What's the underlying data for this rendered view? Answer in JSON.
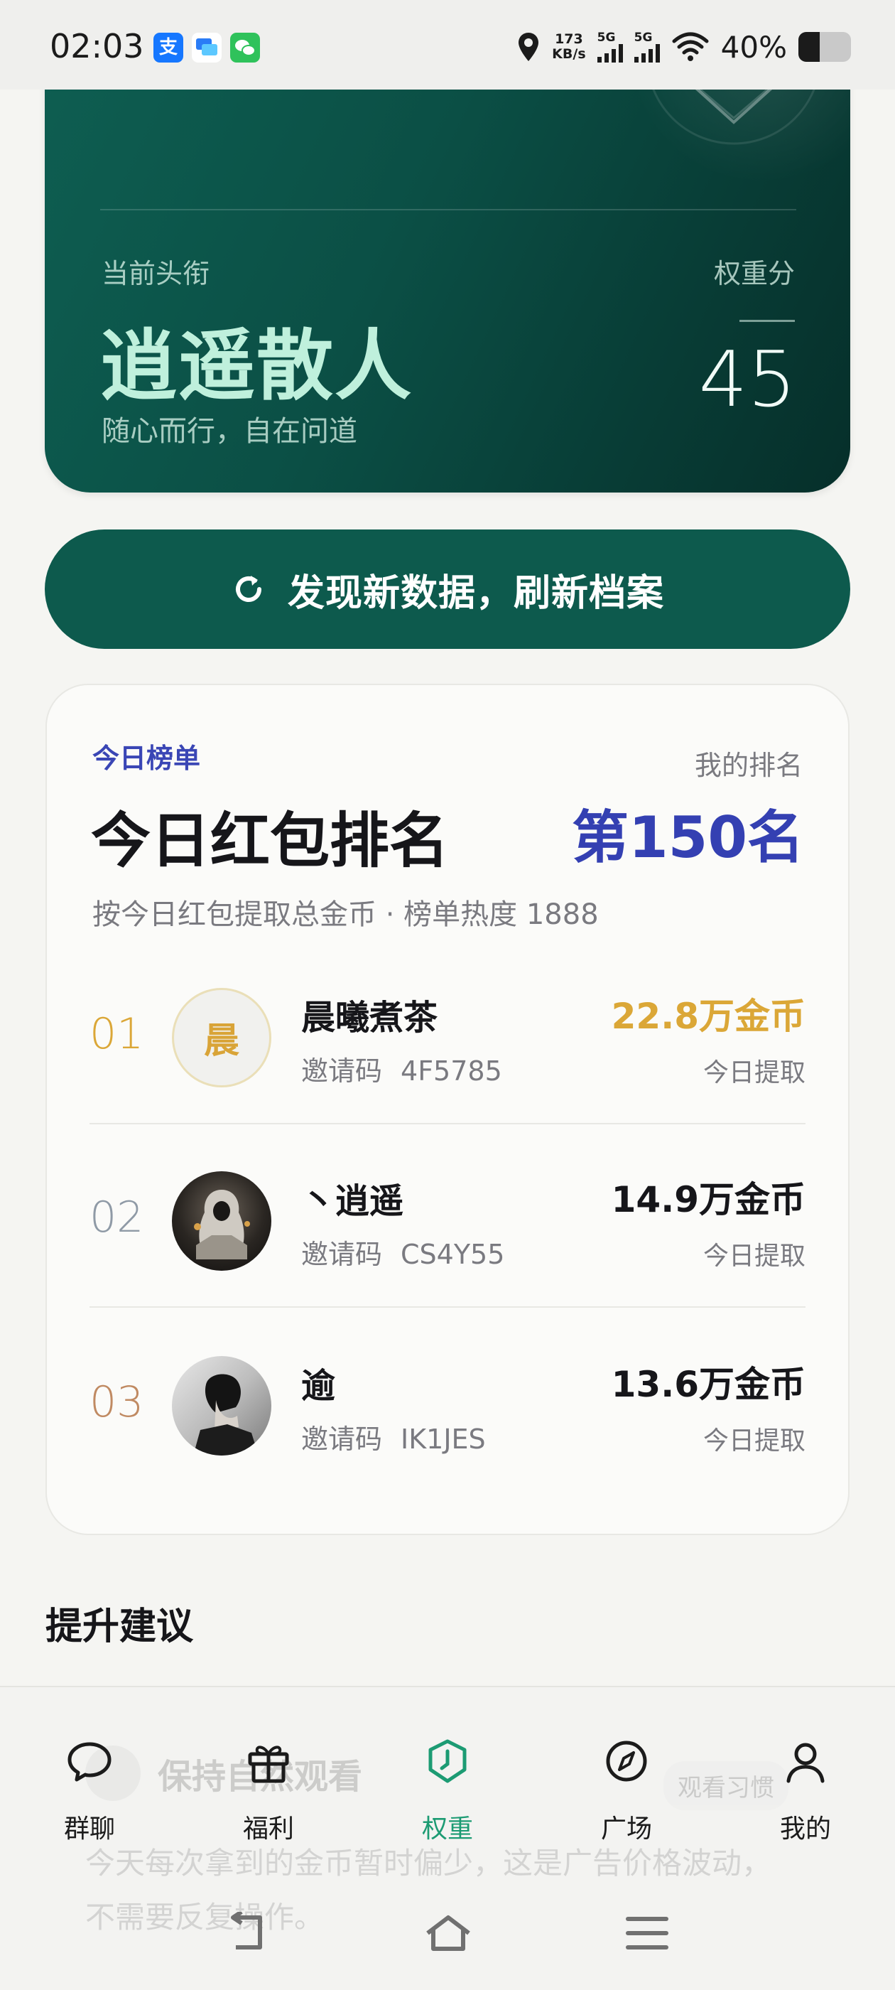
{
  "status_bar": {
    "time": "02:03",
    "app_icons": [
      "alipay-icon",
      "message-icon",
      "wechat-icon"
    ],
    "network_speed_value": "173",
    "network_speed_unit": "KB/s",
    "signal1_label": "5G",
    "signal2_label": "5G",
    "battery_text": "40%",
    "battery_level": 0.4
  },
  "hero": {
    "label": "当前头衔",
    "title": "逍遥散人",
    "subtitle": "随心而行，自在问道",
    "score_label": "权重分",
    "score": "45"
  },
  "refresh_button": {
    "label": "发现新数据，刷新档案",
    "icon": "refresh-icon"
  },
  "ranking": {
    "tag": "今日榜单",
    "my_rank_label": "我的排名",
    "title": "今日红包排名",
    "my_rank": "第150名",
    "description": "按今日红包提取总金币 · 榜单热度 1888",
    "rows": [
      {
        "rank": "01",
        "name": "晨曦煮茶",
        "avatar_text": "晨",
        "invite_label": "邀请码",
        "invite_code": "4F5785",
        "amount": "22.8万金币",
        "amount_label": "今日提取"
      },
      {
        "rank": "02",
        "name": "丶逍遥",
        "avatar_text": "",
        "invite_label": "邀请码",
        "invite_code": "CS4Y55",
        "amount": "14.9万金币",
        "amount_label": "今日提取"
      },
      {
        "rank": "03",
        "name": "逾",
        "avatar_text": "",
        "invite_label": "邀请码",
        "invite_code": "IK1JES",
        "amount": "13.6万金币",
        "amount_label": "今日提取"
      }
    ]
  },
  "suggestions": {
    "title": "提升建议",
    "item_title": "保持自然观看",
    "item_chip": "观看习惯",
    "item_text": "今天每次拿到的金币暂时偏少，这是广告价格波动，不需要反复操作。"
  },
  "bottom_nav": {
    "items": [
      {
        "label": "群聊",
        "icon": "chat-bubble-icon",
        "active": false
      },
      {
        "label": "福利",
        "icon": "gift-icon",
        "active": false
      },
      {
        "label": "权重",
        "icon": "weight-badge-icon",
        "active": true
      },
      {
        "label": "广场",
        "icon": "compass-icon",
        "active": false
      },
      {
        "label": "我的",
        "icon": "user-icon",
        "active": false
      }
    ]
  },
  "colors": {
    "hero_green": "#0b4f45",
    "hero_title": "#bff0dc",
    "accent_blue": "#3440b2",
    "gold": "#dba737",
    "silver": "#8f9aa6",
    "bronze": "#c08a62",
    "nav_active": "#1c9b73"
  }
}
